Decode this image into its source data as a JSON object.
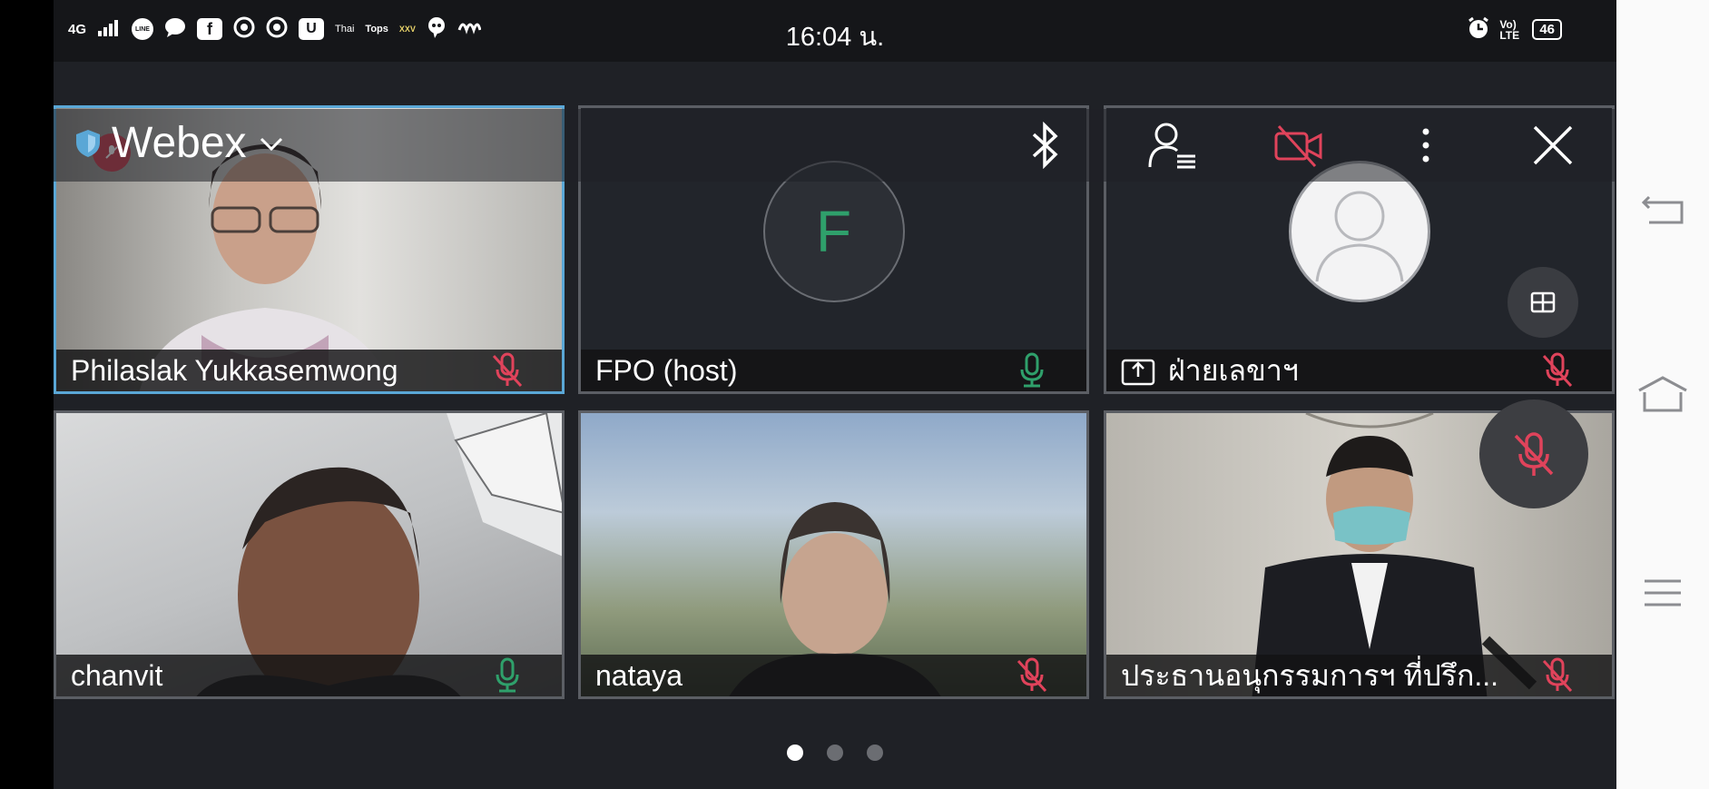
{
  "status_bar": {
    "network": "4G",
    "clock": "16:04 น.",
    "volte": "Vo) LTE",
    "battery": "46",
    "notification_icons": [
      "line-icon",
      "chat-icon",
      "facebook-icon",
      "chrome-icon",
      "chrome-icon",
      "u-app-icon",
      "thai-news-icon",
      "tops-icon",
      "xxv-icon",
      "messenger-icon",
      "waves-icon"
    ],
    "notification_labels": {
      "line": "LINE",
      "fb": "f",
      "u": "U",
      "thai": "Thai",
      "tops": "Tops",
      "xxv": "XXV"
    }
  },
  "header": {
    "app_name": "Webex"
  },
  "colors": {
    "accent": "#5aa7d6",
    "muted_red": "#e0435b",
    "unmuted_green": "#2fa06b",
    "tile_bg": "#22252b"
  },
  "tiles": [
    {
      "name": "Philaslak Yukkasemwong",
      "mic": "muted",
      "active": true,
      "video": "on"
    },
    {
      "name": "FPO (host)",
      "mic": "unmuted",
      "avatar_letter": "F",
      "video": "off"
    },
    {
      "name": "ฝ่ายเลขาฯ",
      "mic": "muted",
      "sharing": true,
      "video": "off"
    },
    {
      "name": "chanvit",
      "mic": "unmuted",
      "video": "on"
    },
    {
      "name": "nataya",
      "mic": "muted",
      "video": "on"
    },
    {
      "name": "ประธานอนุกรรมการฯ ที่ปรึก...",
      "mic": "muted",
      "video": "on"
    }
  ],
  "pager": {
    "pages": 3,
    "current": 1
  }
}
